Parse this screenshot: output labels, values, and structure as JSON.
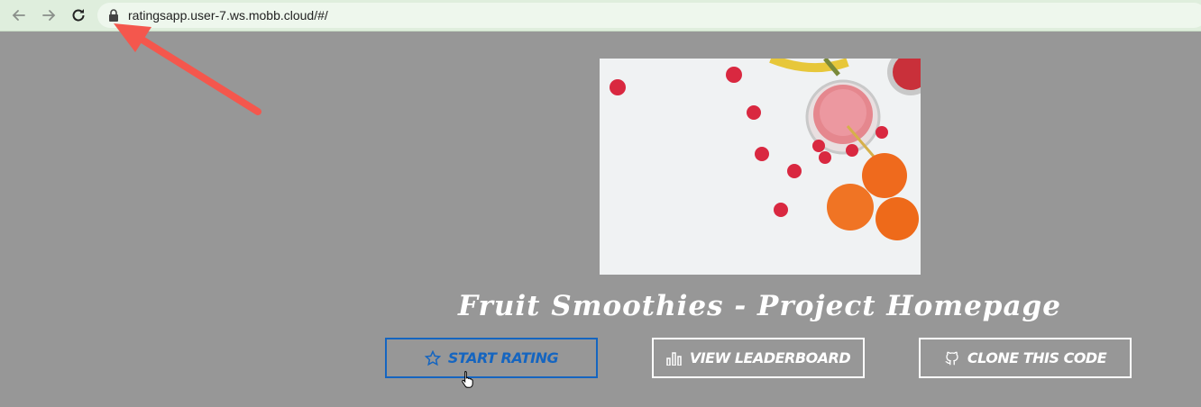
{
  "browser": {
    "url": "ratingsapp.user-7.ws.mobb.cloud/#/",
    "back_icon": "arrow-left-icon",
    "forward_icon": "arrow-right-icon",
    "reload_icon": "reload-icon",
    "lock_icon": "lock-icon"
  },
  "page": {
    "title": "Fruit Smoothies - Project Homepage",
    "hero_image": "smoothie-and-fruit-photo"
  },
  "buttons": [
    {
      "label": "START RATING",
      "icon": "star-icon",
      "color": "#1565c0"
    },
    {
      "label": "VIEW LEADERBOARD",
      "icon": "bar-chart-icon",
      "color": "#ffffff"
    },
    {
      "label": "CLONE THIS CODE",
      "icon": "github-icon",
      "color": "#ffffff"
    }
  ],
  "annotation": {
    "type": "red-arrow",
    "color": "#f4574d"
  },
  "colors": {
    "background": "#979797",
    "toolbar": "#dfeedd",
    "accent": "#1565c0"
  }
}
